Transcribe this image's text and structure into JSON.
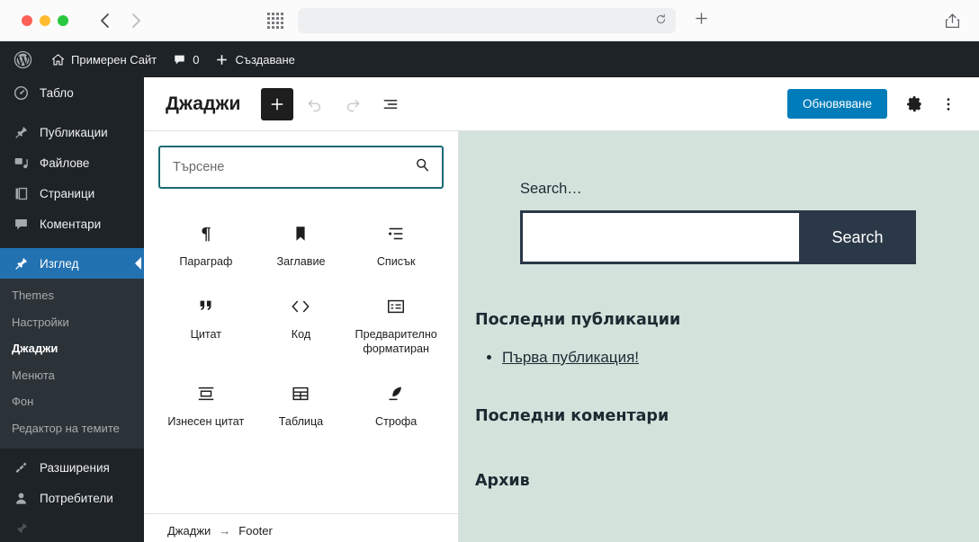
{
  "browser": {
    "url_value": "",
    "reload_icon": "reload-icon",
    "new_tab_label": "+",
    "back_icon": "chevron-left-icon",
    "forward_icon": "chevron-right-icon",
    "grid_icon": "apps-grid-icon",
    "share_icon": "share-icon"
  },
  "adminbar": {
    "wp_logo": "wordpress-logo-icon",
    "site_name": "Примерен Сайт",
    "comments_count": "0",
    "new_label": "Създаване"
  },
  "sidebar": {
    "items": [
      {
        "label": "Табло",
        "icon": "dashboard-icon",
        "current": false
      },
      {
        "label": "Публикации",
        "icon": "pin-icon",
        "current": false
      },
      {
        "label": "Файлове",
        "icon": "media-icon",
        "current": false
      },
      {
        "label": "Страници",
        "icon": "pages-icon",
        "current": false
      },
      {
        "label": "Коментари",
        "icon": "comment-icon",
        "current": false
      },
      {
        "label": "Изглед",
        "icon": "appearance-brush-icon",
        "current": true
      },
      {
        "label": "Разширения",
        "icon": "plugin-icon",
        "current": false
      },
      {
        "label": "Потребители",
        "icon": "user-icon",
        "current": false
      }
    ],
    "submenu": [
      {
        "label": "Themes",
        "current": false
      },
      {
        "label": "Настройки",
        "current": false
      },
      {
        "label": "Джаджи",
        "current": true
      },
      {
        "label": "Менюта",
        "current": false
      },
      {
        "label": "Фон",
        "current": false
      },
      {
        "label": "Редактор на темите",
        "current": false
      }
    ]
  },
  "editor_header": {
    "title": "Джаджи",
    "add_block_label": "+",
    "undo_icon": "undo-icon",
    "redo_icon": "redo-icon",
    "list_view_icon": "list-view-icon",
    "update_label": "Обновяване",
    "settings_icon": "gear-icon",
    "more_icon": "more-vertical-icon",
    "accent_color": "#007cba"
  },
  "inserter": {
    "search_placeholder": "Търсене",
    "search_value": "",
    "search_icon": "search-icon",
    "border_color": "#1a6b75",
    "blocks": [
      {
        "label": "Параграф",
        "icon": "paragraph-icon"
      },
      {
        "label": "Заглавие",
        "icon": "heading-bookmark-icon"
      },
      {
        "label": "Списък",
        "icon": "list-icon"
      },
      {
        "label": "Цитат",
        "icon": "quote-icon"
      },
      {
        "label": "Код",
        "icon": "code-icon"
      },
      {
        "label": "Предварително форматиран",
        "icon": "preformatted-icon"
      },
      {
        "label": "Изнесен цитат",
        "icon": "pullquote-icon"
      },
      {
        "label": "Таблица",
        "icon": "table-icon"
      },
      {
        "label": "Строфа",
        "icon": "verse-feather-icon"
      }
    ]
  },
  "breadcrumb": {
    "root": "Джаджи",
    "separator": "→",
    "current": "Footer"
  },
  "preview": {
    "background_color": "#d3e3dc",
    "search_label": "Search…",
    "search_value": "",
    "search_button_label": "Search",
    "recent_posts_heading": "Последни публикации",
    "recent_posts": [
      "Първа публикация!"
    ],
    "recent_comments_heading": "Последни коментари",
    "archives_heading": "Архив"
  }
}
